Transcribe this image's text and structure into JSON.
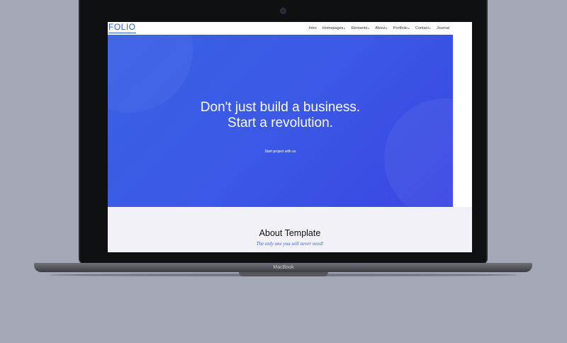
{
  "device": {
    "brand_label": "MacBook"
  },
  "nav": {
    "logo": "FOLIO",
    "items": [
      {
        "label": "Intro",
        "has_caret": false
      },
      {
        "label": "Homepages",
        "has_caret": true
      },
      {
        "label": "Elements",
        "has_caret": true
      },
      {
        "label": "About",
        "has_caret": true
      },
      {
        "label": "Portfolio",
        "has_caret": true
      },
      {
        "label": "Contact",
        "has_caret": true
      },
      {
        "label": "Journal",
        "has_caret": false
      }
    ],
    "caret_glyph": "▸"
  },
  "hero": {
    "title_line1": "Don't just build a business.",
    "title_line2": "Start a revolution.",
    "cta": "Start project with us"
  },
  "about": {
    "title": "About Template",
    "subtitle": "The only one you will never need!"
  },
  "colors": {
    "accent": "#2d5fd9",
    "hero_start": "#3a60e4",
    "hero_end": "#3a46e2",
    "background": "#a3a7b6"
  }
}
